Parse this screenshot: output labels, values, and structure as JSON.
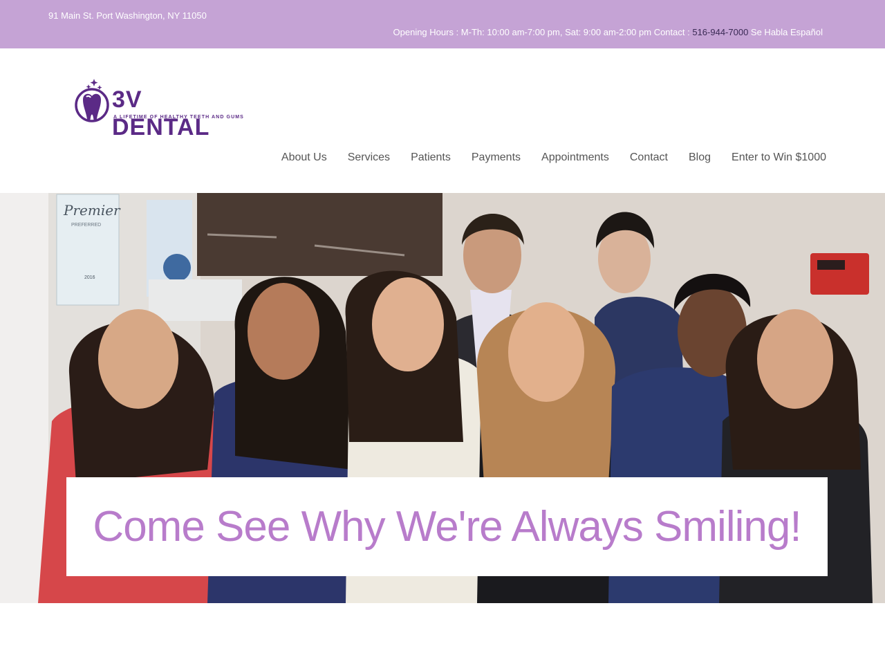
{
  "topbar": {
    "address": "91 Main St. Port Washington, NY 11050",
    "hours_text": "Opening Hours : M-Th: 10:00 am-7:00 pm, Sat: 9:00 am-2:00 pm  Contact : ",
    "phone": "516-944-7000",
    "spanish": " Se Habla Español"
  },
  "logo": {
    "brand": "3V DENTAL",
    "tagline": "A LIFETIME OF HEALTHY TEETH AND GUMS"
  },
  "nav": {
    "items": [
      "About Us",
      "Services",
      "Patients",
      "Payments",
      "Appointments",
      "Contact",
      "Blog",
      "Enter to Win $1000"
    ]
  },
  "hero": {
    "headline": "Come See Why We're Always Smiling!",
    "sign_text": "Premier",
    "sign_sub": "PREFERRED",
    "sign_year": "2016"
  },
  "colors": {
    "topbar": "#c5a3d5",
    "brand_purple": "#5b2a86",
    "headline": "#b87ccb"
  }
}
